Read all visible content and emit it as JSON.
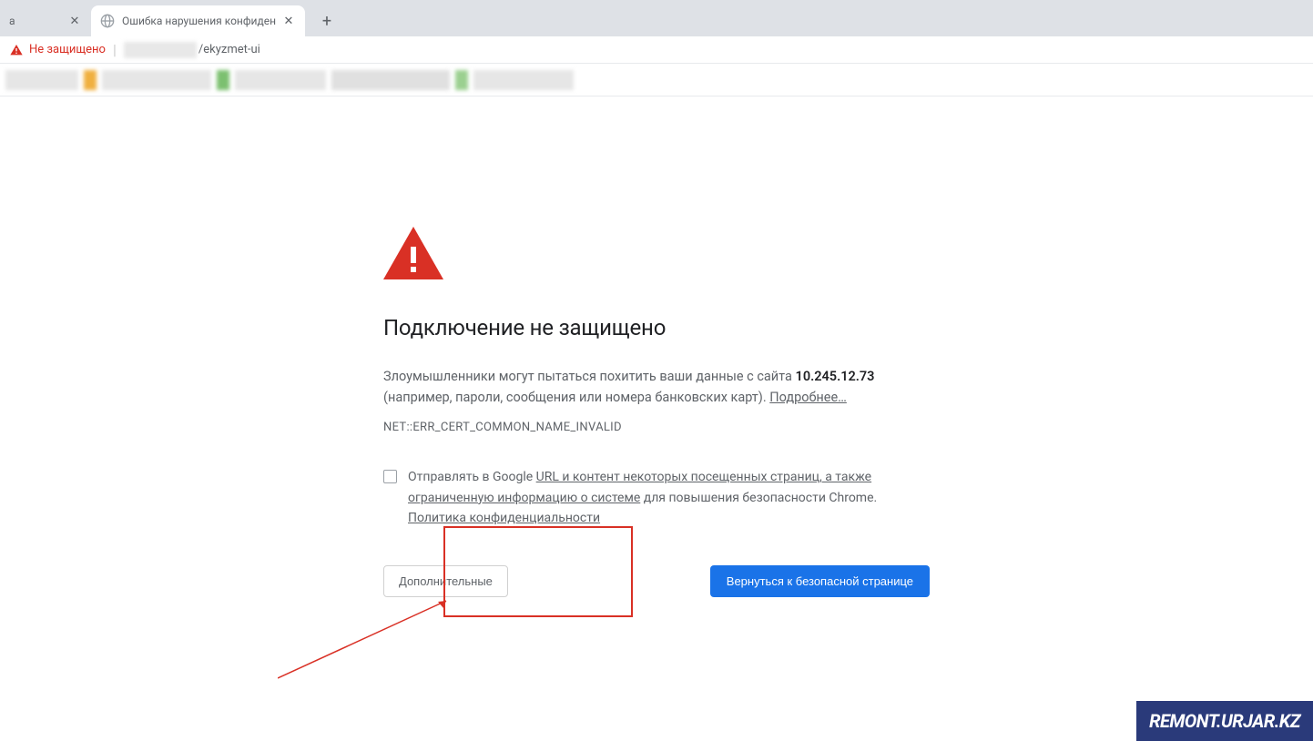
{
  "tabs": {
    "inactive": {
      "title_char": "a"
    },
    "active": {
      "title": "Ошибка нарушения конфиден"
    },
    "new_tab_glyph": "+"
  },
  "address_bar": {
    "security_text": "Не защищено",
    "url_path": "/ekyzmet-ui"
  },
  "error": {
    "title": "Подключение не защищено",
    "msg_before_host": "Злоумышленники могут пытаться похитить ваши данные с сайта ",
    "host": "10.245.12.73",
    "msg_line2": " (например, пароли, сообщения или номера банковских карт). ",
    "learn_more": "Подробнее…",
    "code": "NET::ERR_CERT_COMMON_NAME_INVALID",
    "opt_in_prefix": "Отправлять в Google ",
    "opt_in_link1": "URL и контент некоторых посещенных страниц, а также ограниченную информацию о системе",
    "opt_in_middle": " для повышения безопасности Chrome. ",
    "opt_in_link2": "Политика конфиденциальности",
    "btn_advanced": "Дополнительные",
    "btn_back": "Вернуться к безопасной странице"
  },
  "watermark": "REMONT.URJAR.KZ",
  "colors": {
    "danger": "#d93025",
    "primary": "#1a73e8"
  }
}
